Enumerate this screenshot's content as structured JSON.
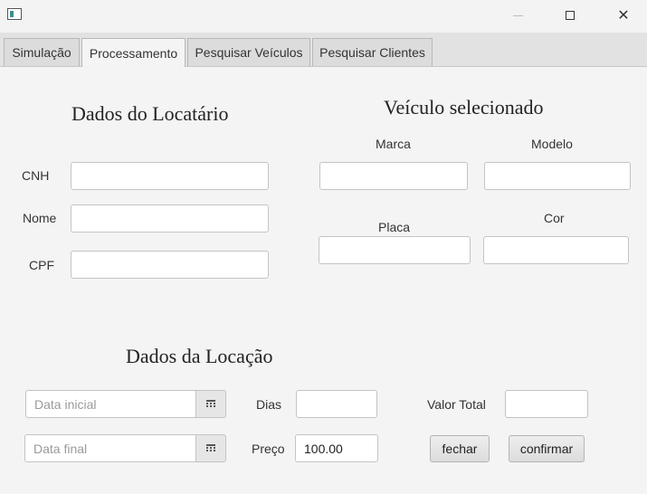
{
  "window": {
    "icons": {
      "app": "app-icon",
      "minimize": "minimize-icon",
      "maximize": "maximize-icon",
      "close": "close-icon"
    },
    "close_glyph": "✕"
  },
  "tabs": [
    {
      "label": "Simulação",
      "active": false
    },
    {
      "label": "Processamento",
      "active": true
    },
    {
      "label": "Pesquisar Veículos",
      "active": false
    },
    {
      "label": "Pesquisar Clientes",
      "active": false
    }
  ],
  "locatario": {
    "title": "Dados do Locatário",
    "cnh_label": "CNH",
    "cnh_value": "",
    "nome_label": "Nome",
    "nome_value": "",
    "cpf_label": "CPF",
    "cpf_value": ""
  },
  "veiculo": {
    "title": "Veículo selecionado",
    "marca_label": "Marca",
    "marca_value": "",
    "modelo_label": "Modelo",
    "modelo_value": "",
    "placa_label": "Placa",
    "placa_value": "",
    "cor_label": "Cor",
    "cor_value": ""
  },
  "locacao": {
    "title": "Dados da Locação",
    "data_inicial_placeholder": "Data inicial",
    "data_final_placeholder": "Data final",
    "dias_label": "Dias",
    "dias_value": "",
    "preco_label": "Preço",
    "preco_value": "100.00",
    "valor_total_label": "Valor Total",
    "valor_total_value": "",
    "calendar_icon": "calendar-icon"
  },
  "actions": {
    "fechar_label": "fechar",
    "confirmar_label": "confirmar"
  }
}
